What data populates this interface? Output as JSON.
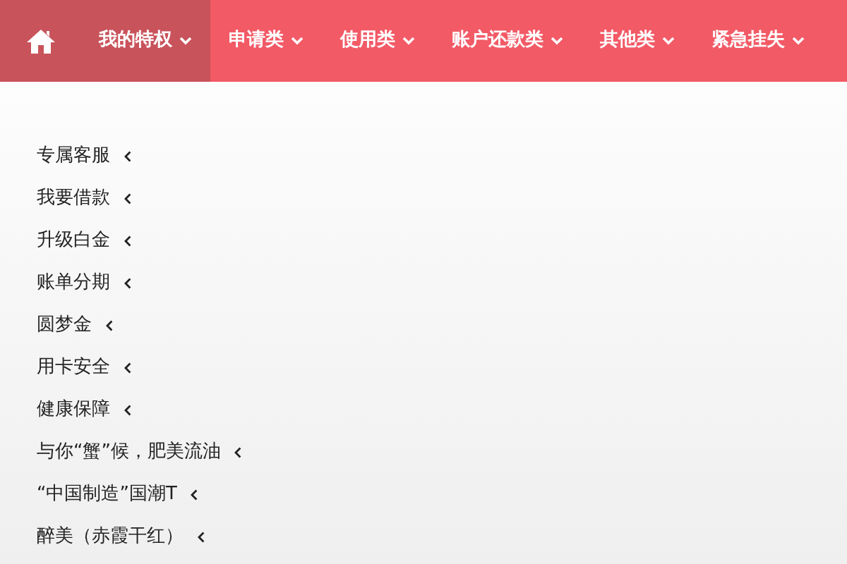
{
  "nav": {
    "tabs": [
      {
        "label": "我的特权",
        "selected": true
      },
      {
        "label": "申请类",
        "selected": false
      },
      {
        "label": "使用类",
        "selected": false
      },
      {
        "label": "账户还款类",
        "selected": false
      },
      {
        "label": "其他类",
        "selected": false
      },
      {
        "label": "紧急挂失",
        "selected": false
      }
    ]
  },
  "menu": {
    "items": [
      {
        "label": "专属客服"
      },
      {
        "label": "我要借款"
      },
      {
        "label": "升级白金"
      },
      {
        "label": "账单分期"
      },
      {
        "label": "圆梦金"
      },
      {
        "label": "用卡安全"
      },
      {
        "label": "健康保障"
      },
      {
        "label": "与你“蟹”候，肥美流油"
      },
      {
        "label": "“中国制造”国潮T"
      },
      {
        "label": "醉美（赤霞干红）"
      }
    ]
  }
}
